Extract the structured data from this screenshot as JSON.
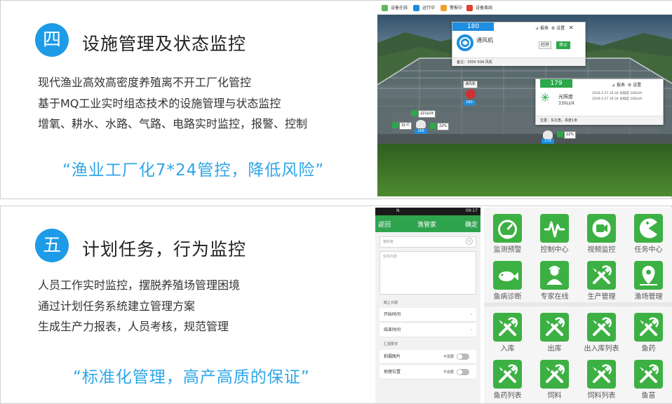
{
  "section4": {
    "number": "四",
    "title": "设施管理及状态监控",
    "bullets": [
      "现代渔业高效高密度养殖离不开工厂化管控",
      "基于MQ工业实时组态技术的设施管理与状态监控",
      "增氧、耕水、水路、气路、电路实时监控，报警、控制"
    ],
    "slogan": "“渔业工厂化7*24管控，降低风险”"
  },
  "scene": {
    "legend": [
      {
        "label": "设备在线",
        "color": "#5cb85c"
      },
      {
        "label": "运行中",
        "color": "#1e8ee0"
      },
      {
        "label": "警报中",
        "color": "#f0a030"
      },
      {
        "label": "设备离线",
        "color": "#e04030"
      }
    ],
    "popup_fan": {
      "id": "180",
      "name": "通风机",
      "tools_report": "报表",
      "tools_settings": "设置",
      "btn_open": "打开",
      "btn_stop": "停止",
      "note": "备注：330V 50A 风机"
    },
    "popup_light": {
      "id": "179",
      "name": "光照度",
      "value": "330LUX",
      "tools_report": "报表",
      "tools_settings": "设置",
      "log": [
        "2016-2-27 16:34  光照度  330LUX",
        "2016-2-27 16:34  光照度  330LUX"
      ],
      "location": "位置：东北角，高度1米"
    },
    "tags": {
      "fan_tag": "通风机",
      "fan_chip": "180",
      "lux_tag": "221LUX",
      "lux_chip": "189",
      "temp_tag": "31℃",
      "hum1_tag": "22%",
      "hum2_tag": "22%",
      "chip2": "179"
    }
  },
  "section5": {
    "number": "五",
    "title": "计划任务，行为监控",
    "bullets": [
      "人员工作实时监控，摆脱养殖场管理困境",
      "通过计划任务系统建立管理方案",
      "生成生产力报表，人员考核，规范管理"
    ],
    "slogan": "“标准化管理，高产高质的保证”"
  },
  "phone": {
    "status_time": "09:17",
    "status_left": "N",
    "back": "返回",
    "title": "渔管家",
    "confirm": "确定",
    "receiver_placeholder": "接收者",
    "content_placeholder": "任务内容",
    "section_date": "截止日期",
    "start_time": "开始时间",
    "end_time": "结束时间",
    "section_req": "汇报要求",
    "photo": "拍摄图片",
    "location": "地理位置",
    "need_label": "不需要"
  },
  "grid": {
    "tiles": [
      {
        "label": "监测预警",
        "icon": "gauge-icon"
      },
      {
        "label": "控制中心",
        "icon": "pulse-icon"
      },
      {
        "label": "视频监控",
        "icon": "video-camera-icon"
      },
      {
        "label": "任务中心",
        "icon": "pacman-icon"
      },
      {
        "label": "鱼病诊断",
        "icon": "fish-icon"
      },
      {
        "label": "专家在线",
        "icon": "expert-icon"
      },
      {
        "label": "生产管理",
        "icon": "tools-icon"
      },
      {
        "label": "渔场管理",
        "icon": "map-pin-icon"
      },
      {
        "label": "入库",
        "icon": "tools-icon"
      },
      {
        "label": "出库",
        "icon": "tools-icon"
      },
      {
        "label": "出入库列表",
        "icon": "tools-icon"
      },
      {
        "label": "鱼药",
        "icon": "tools-icon"
      },
      {
        "label": "鱼药列表",
        "icon": "tools-icon"
      },
      {
        "label": "饲料",
        "icon": "tools-icon"
      },
      {
        "label": "饲料列表",
        "icon": "tools-icon"
      },
      {
        "label": "鱼苗",
        "icon": "tools-icon"
      }
    ]
  }
}
